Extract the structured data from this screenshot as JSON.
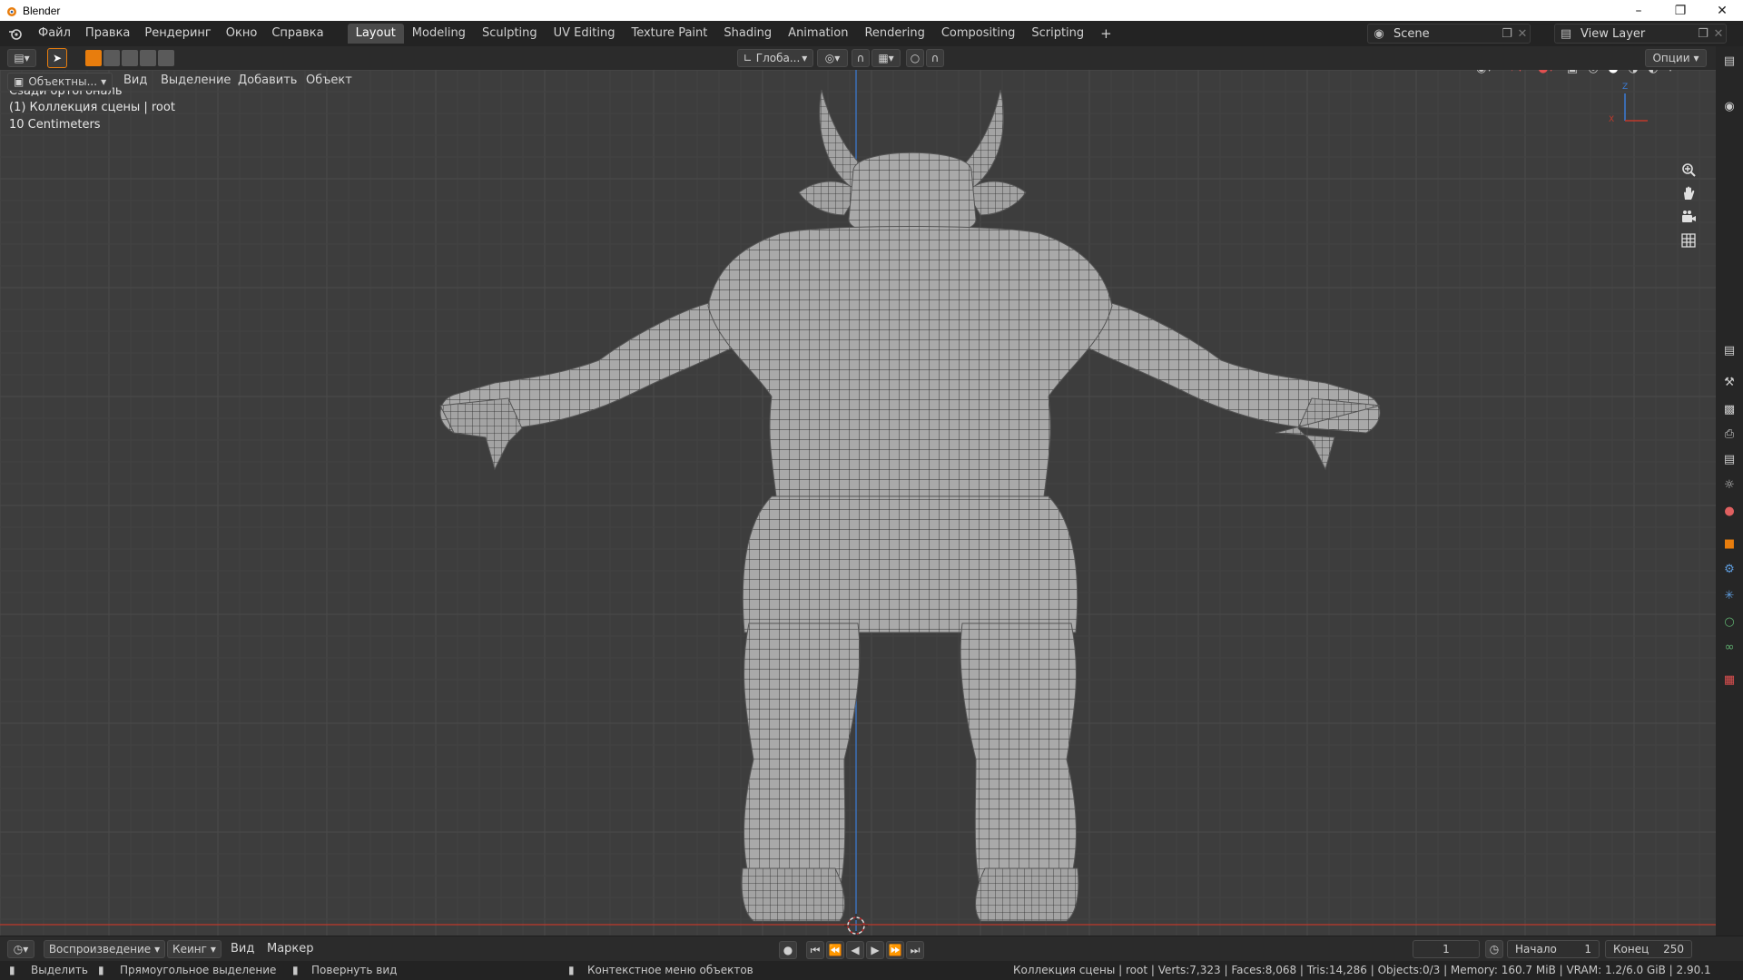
{
  "window": {
    "title": "Blender",
    "minimize": "–",
    "maximize": "❐",
    "close": "✕"
  },
  "menu": {
    "items": [
      "Файл",
      "Правка",
      "Рендеринг",
      "Окно",
      "Справка"
    ]
  },
  "workspaces": {
    "tabs": [
      "Layout",
      "Modeling",
      "Sculpting",
      "UV Editing",
      "Texture Paint",
      "Shading",
      "Animation",
      "Rendering",
      "Compositing",
      "Scripting"
    ],
    "active": "Layout",
    "add": "+"
  },
  "scene": {
    "name": "Scene",
    "view_layer": "View Layer"
  },
  "toolheader": {
    "transform_orientation": "Глоба...",
    "options": "Опции"
  },
  "viewheader": {
    "mode": "Объектны...",
    "menus": [
      "Вид",
      "Выделение",
      "Добавить",
      "Объект"
    ]
  },
  "viewport": {
    "view_name": "Сзади ортогональ",
    "collection": "(1) Коллекция сцены | root",
    "scale": "10 Centimeters",
    "axis_x": "X",
    "axis_z": "Z"
  },
  "timeline": {
    "playback": "Воспроизведение",
    "keying": "Кеинг",
    "view": "Вид",
    "marker": "Маркер",
    "current_frame": "1",
    "start_label": "Начало",
    "start_value": "1",
    "end_label": "Конец",
    "end_value": "250"
  },
  "statusbar": {
    "select": "Выделить",
    "box_select": "Прямоугольное выделение",
    "rotate_view": "Повернуть вид",
    "context_menu": "Контекстное меню объектов",
    "stats": "Коллекция сцены | root | Verts:7,323 | Faces:8,068 | Tris:14,286 | Objects:0/3 | Memory: 160.7 MiB | VRAM: 1.2/6.0 GiB | 2.90.1"
  },
  "colors": {
    "accent": "#e87d0d",
    "viewport_bg": "#3d3d3d",
    "x_axis": "#c0392b",
    "y_axis": "#3b7dd8"
  }
}
